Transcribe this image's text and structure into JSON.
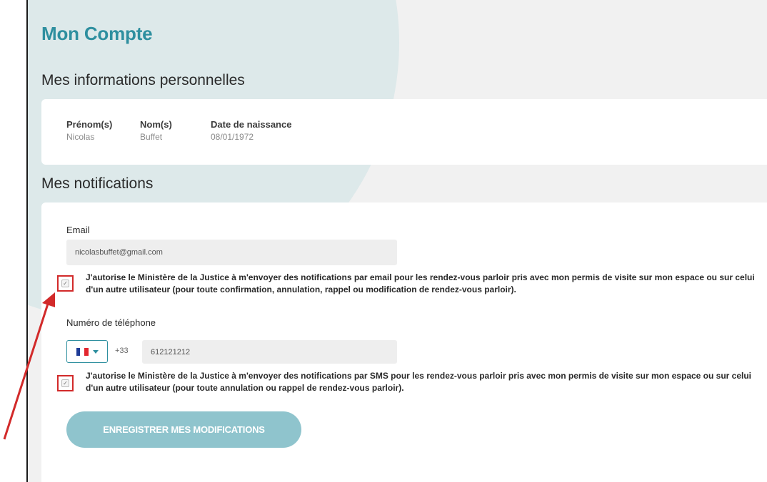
{
  "page": {
    "title": "Mon Compte"
  },
  "personal": {
    "title": "Mes informations personnelles",
    "fields": [
      {
        "label": "Prénom(s)",
        "value": "Nicolas"
      },
      {
        "label": "Nom(s)",
        "value": "Buffet"
      },
      {
        "label": "Date de naissance",
        "value": "08/01/1972"
      }
    ]
  },
  "notifications": {
    "title": "Mes notifications",
    "email": {
      "label": "Email",
      "value": "nicolasbuffet@gmail.com",
      "consent_checked": true,
      "consent_text": "J'autorise le Ministère de la Justice à m'envoyer des notifications par email pour les rendez-vous parloir pris avec mon permis de visite sur mon espace ou sur celui d'un autre utilisateur (pour toute confirmation, annulation, rappel ou modification de rendez-vous parloir)."
    },
    "phone": {
      "label": "Numéro de téléphone",
      "country_flag": "france-flag-icon",
      "dial_code": "+33",
      "value": "612121212",
      "consent_checked": true,
      "consent_text": "J'autorise le Ministère de la Justice à m'envoyer des notifications par SMS pour les rendez-vous parloir pris avec mon permis de visite sur mon espace ou sur celui d'un autre utilisateur (pour toute annulation ou rappel de rendez-vous parloir)."
    },
    "save_label": "ENREGISTRER MES MODIFICATIONS"
  },
  "colors": {
    "accent": "#2e8f9f",
    "button": "#8fc4cd",
    "highlight": "#d22a2a",
    "flag_blue": "#1f3c97",
    "flag_white": "#ffffff",
    "flag_red": "#e2262e"
  }
}
